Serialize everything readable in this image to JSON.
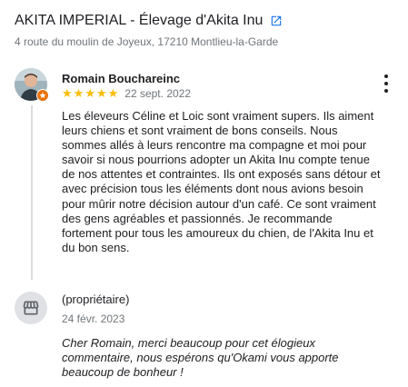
{
  "business": {
    "name": "AKITA IMPERIAL - Élevage d'Akita Inu",
    "address": "4 route du moulin de Joyeux, 17210 Montlieu-la-Garde"
  },
  "review": {
    "author": "Romain Bouchareinc",
    "rating": 5,
    "stars": "★★★★★",
    "date": "22 sept. 2022",
    "text": "Les éleveurs Céline et Loic sont vraiment supers. Ils aiment leurs chiens et sont vraiment de bons conseils. Nous sommes allés à leurs rencontre ma compagne et moi pour savoir si nous pourrions adopter un Akita Inu compte tenue de nos attentes et contraintes. Ils ont exposés sans détour et avec précision tous les éléments dont nous avions besoin pour mûrir notre décision autour d'un café. Ce sont vraiment des gens agréables et passionnés. Je recommande fortement pour tous les amoureux du chien, de l'Akita Inu et du bon sens."
  },
  "owner_response": {
    "label": "(propriétaire)",
    "date": "24 févr. 2023",
    "text": "Cher Romain, merci beaucoup pour cet élogieux commentaire, nous espérons qu'Okami vous apporte beaucoup de bonheur !"
  },
  "colors": {
    "star": "#fbbc04",
    "link_icon": "#1a73e8",
    "secondary_text": "#70757a",
    "badge": "#e8710a"
  },
  "icons": {
    "open_link": "open-in-new-icon",
    "more": "more-vert-icon",
    "owner": "storefront-icon",
    "badge": "local-guide-badge-icon"
  }
}
